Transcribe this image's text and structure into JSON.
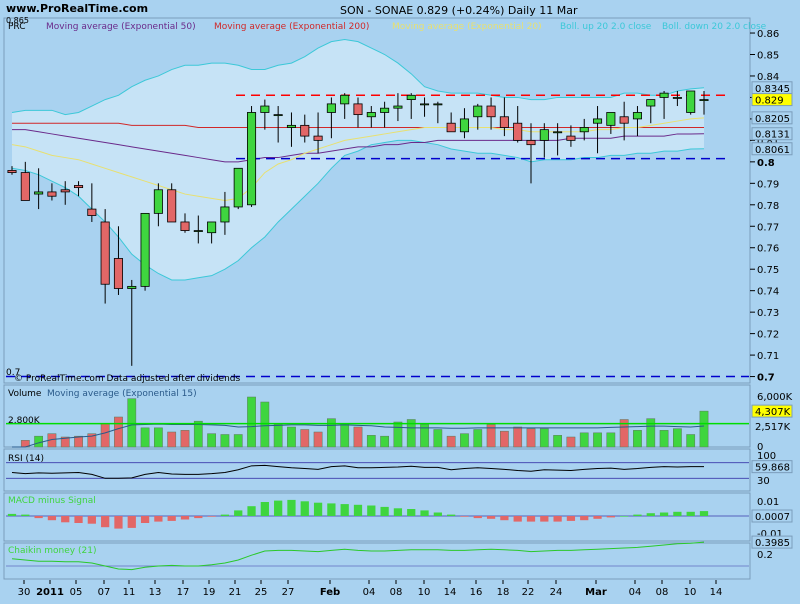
{
  "header": {
    "watermark": "www.ProRealTime.com",
    "title": "SON - SONAE   0.829 (+0.24%)   Daily  11 Mar"
  },
  "price_panel": {
    "legend": [
      "PRC",
      "Moving average (Exponential 50)",
      "Moving average (Exponential 200)",
      "Moving average (Exponential 20)",
      "Boll. up 20 2.0 close",
      "Boll. down 20 2.0 close"
    ],
    "note": "© ProRealTime.com  Data adjusted after dividends",
    "corner_top": "0.865",
    "corner_bottom": "0.7",
    "ticks": [
      "0.86",
      "0.85",
      "0.84",
      "0.83",
      "0.82",
      "0.81",
      "0.8",
      "0.79",
      "0.78",
      "0.77",
      "0.76",
      "0.75",
      "0.74",
      "0.73",
      "0.72",
      "0.71",
      "0.7"
    ],
    "tags": {
      "boll_up": "0.8345",
      "close": "0.829",
      "ema20": "0.8205",
      "ema50": "0.8131",
      "boll_down": "0.8061"
    }
  },
  "volume_panel": {
    "legend": [
      "Volume",
      "Moving average (Exponential 15)"
    ],
    "level_label": "2.800K",
    "ticks": [
      "6,000K",
      "0"
    ],
    "tags": {
      "volume": "4,307K",
      "ma": "2,517K"
    }
  },
  "rsi_panel": {
    "legend": "RSI (14)",
    "ticks": [
      "100",
      "30"
    ],
    "tag": "59.868"
  },
  "macd_panel": {
    "legend": "MACD minus Signal",
    "ticks": [
      "0.01",
      "-0.01"
    ],
    "tag": "0.0007"
  },
  "chaikin_panel": {
    "legend": "Chaikin money (21)",
    "ticks": [
      "0.2"
    ],
    "tag": "0.3985"
  },
  "x_axis": {
    "labels": [
      "30",
      "2011",
      "05",
      "07",
      "11",
      "13",
      "17",
      "19",
      "21",
      "25",
      "27",
      "Feb",
      "04",
      "08",
      "10",
      "14",
      "16",
      "18",
      "22",
      "24",
      "Mar",
      "04",
      "08",
      "10",
      "14"
    ]
  },
  "colors": {
    "up": "#3fd53f",
    "down": "#e26767",
    "bg": "#a9d2f0",
    "boll": "#3cc8d8",
    "ema20": "#e8e070",
    "ema50": "#6a2a8a",
    "ema200": "#d02828",
    "resist": "#ff0000",
    "support": "#0000cc"
  },
  "chart_data": {
    "type": "candlestick",
    "dates": [
      "29 Dec",
      "30 Dec",
      "31 Dec",
      "03 Jan",
      "04 Jan",
      "05 Jan",
      "06 Jan",
      "07 Jan",
      "10 Jan",
      "11 Jan",
      "12 Jan",
      "13 Jan",
      "14 Jan",
      "17 Jan",
      "18 Jan",
      "19 Jan",
      "20 Jan",
      "21 Jan",
      "24 Jan",
      "25 Jan",
      "26 Jan",
      "27 Jan",
      "28 Jan",
      "31 Jan",
      "01 Feb",
      "02 Feb",
      "03 Feb",
      "04 Feb",
      "07 Feb",
      "08 Feb",
      "09 Feb",
      "10 Feb",
      "11 Feb",
      "14 Feb",
      "15 Feb",
      "16 Feb",
      "17 Feb",
      "18 Feb",
      "21 Feb",
      "22 Feb",
      "23 Feb",
      "24 Feb",
      "25 Feb",
      "28 Feb",
      "01 Mar",
      "02 Mar",
      "03 Mar",
      "04 Mar",
      "07 Mar",
      "08 Mar",
      "09 Mar",
      "10 Mar",
      "11 Mar"
    ],
    "open": [
      0.796,
      0.795,
      0.785,
      0.786,
      0.787,
      0.789,
      0.778,
      0.772,
      0.755,
      0.741,
      0.742,
      0.776,
      0.787,
      0.772,
      0.768,
      0.767,
      0.772,
      0.779,
      0.78,
      0.823,
      0.822,
      0.816,
      0.817,
      0.812,
      0.823,
      0.827,
      0.827,
      0.821,
      0.823,
      0.825,
      0.829,
      0.827,
      0.827,
      0.818,
      0.814,
      0.821,
      0.826,
      0.821,
      0.818,
      0.81,
      0.81,
      0.814,
      0.812,
      0.814,
      0.818,
      0.817,
      0.821,
      0.82,
      0.826,
      0.83,
      0.83,
      0.823,
      0.829
    ],
    "high": [
      0.798,
      0.8,
      0.797,
      0.79,
      0.791,
      0.791,
      0.79,
      0.778,
      0.77,
      0.745,
      0.775,
      0.79,
      0.79,
      0.776,
      0.775,
      0.772,
      0.786,
      0.796,
      0.826,
      0.829,
      0.826,
      0.823,
      0.822,
      0.823,
      0.83,
      0.832,
      0.83,
      0.826,
      0.828,
      0.832,
      0.832,
      0.83,
      0.828,
      0.823,
      0.825,
      0.827,
      0.83,
      0.83,
      0.826,
      0.818,
      0.818,
      0.818,
      0.817,
      0.82,
      0.826,
      0.822,
      0.828,
      0.826,
      0.829,
      0.833,
      0.833,
      0.832,
      0.833
    ],
    "low": [
      0.794,
      0.783,
      0.778,
      0.782,
      0.78,
      0.784,
      0.772,
      0.734,
      0.738,
      0.705,
      0.74,
      0.77,
      0.772,
      0.767,
      0.762,
      0.762,
      0.766,
      0.778,
      0.779,
      0.815,
      0.809,
      0.807,
      0.809,
      0.804,
      0.811,
      0.82,
      0.816,
      0.816,
      0.816,
      0.819,
      0.82,
      0.821,
      0.818,
      0.816,
      0.811,
      0.815,
      0.815,
      0.812,
      0.809,
      0.79,
      0.802,
      0.803,
      0.807,
      0.81,
      0.804,
      0.813,
      0.81,
      0.812,
      0.818,
      0.82,
      0.826,
      0.822,
      0.822
    ],
    "close": [
      0.795,
      0.782,
      0.786,
      0.784,
      0.786,
      0.788,
      0.775,
      0.743,
      0.741,
      0.742,
      0.776,
      0.787,
      0.772,
      0.768,
      0.768,
      0.772,
      0.779,
      0.797,
      0.823,
      0.826,
      0.822,
      0.817,
      0.812,
      0.81,
      0.827,
      0.831,
      0.822,
      0.823,
      0.825,
      0.826,
      0.831,
      0.827,
      0.827,
      0.814,
      0.82,
      0.826,
      0.821,
      0.816,
      0.81,
      0.808,
      0.815,
      0.814,
      0.81,
      0.816,
      0.82,
      0.823,
      0.818,
      0.823,
      0.829,
      0.832,
      0.83,
      0.833,
      0.829
    ],
    "volume_K": [
      0,
      800,
      1300,
      1600,
      1200,
      1300,
      1600,
      2800,
      3600,
      5800,
      2300,
      2300,
      1800,
      2000,
      3100,
      1600,
      1500,
      1500,
      6000,
      5400,
      2700,
      2400,
      2100,
      1800,
      3400,
      2800,
      2400,
      1400,
      1300,
      3000,
      3300,
      2700,
      2100,
      1300,
      1600,
      2100,
      2700,
      1900,
      2400,
      2200,
      2200,
      1400,
      1200,
      1700,
      1700,
      1700,
      3300,
      2000,
      3400,
      2000,
      2200,
      1500,
      4307
    ],
    "volume_ema15_K": [
      0,
      0,
      500,
      900,
      1050,
      1200,
      1300,
      1700,
      2200,
      2650,
      2700,
      2750,
      2700,
      2700,
      2700,
      2650,
      2600,
      2400,
      2450,
      2550,
      2600,
      2650,
      2650,
      2600,
      2600,
      2650,
      2600,
      2550,
      2400,
      2350,
      2300,
      2300,
      2300,
      2250,
      2250,
      2300,
      2300,
      2300,
      2300,
      2300,
      2300,
      2300,
      2300,
      2300,
      2300,
      2350,
      2400,
      2450,
      2500,
      2500,
      2450,
      2400,
      2517
    ],
    "ema20": [
      0.808,
      0.807,
      0.805,
      0.803,
      0.802,
      0.801,
      0.799,
      0.797,
      0.795,
      0.793,
      0.791,
      0.789,
      0.787,
      0.785,
      0.784,
      0.783,
      0.782,
      0.783,
      0.788,
      0.795,
      0.799,
      0.801,
      0.804,
      0.806,
      0.808,
      0.81,
      0.811,
      0.812,
      0.813,
      0.814,
      0.815,
      0.816,
      0.816,
      0.816,
      0.816,
      0.816,
      0.816,
      0.815,
      0.815,
      0.814,
      0.814,
      0.814,
      0.814,
      0.814,
      0.815,
      0.815,
      0.816,
      0.816,
      0.817,
      0.818,
      0.819,
      0.82,
      0.8205
    ],
    "ema50": [
      0.815,
      0.815,
      0.814,
      0.813,
      0.812,
      0.811,
      0.81,
      0.809,
      0.808,
      0.807,
      0.806,
      0.805,
      0.804,
      0.803,
      0.802,
      0.801,
      0.8,
      0.8,
      0.801,
      0.802,
      0.802,
      0.803,
      0.804,
      0.804,
      0.805,
      0.806,
      0.807,
      0.807,
      0.808,
      0.808,
      0.809,
      0.809,
      0.81,
      0.81,
      0.81,
      0.81,
      0.81,
      0.81,
      0.81,
      0.81,
      0.81,
      0.81,
      0.811,
      0.811,
      0.811,
      0.811,
      0.812,
      0.812,
      0.812,
      0.812,
      0.813,
      0.813,
      0.8131
    ],
    "ema200": [
      0.818,
      0.818,
      0.818,
      0.818,
      0.818,
      0.818,
      0.818,
      0.818,
      0.818,
      0.817,
      0.817,
      0.817,
      0.817,
      0.817,
      0.816,
      0.816,
      0.816,
      0.816,
      0.816,
      0.816,
      0.816,
      0.816,
      0.816,
      0.816,
      0.816,
      0.816,
      0.816,
      0.816,
      0.816,
      0.816,
      0.816,
      0.816,
      0.816,
      0.816,
      0.816,
      0.816,
      0.816,
      0.816,
      0.816,
      0.816,
      0.816,
      0.816,
      0.816,
      0.816,
      0.816,
      0.816,
      0.816,
      0.816,
      0.816,
      0.816,
      0.816,
      0.816,
      0.816
    ],
    "boll_up": [
      0.823,
      0.824,
      0.824,
      0.824,
      0.822,
      0.823,
      0.826,
      0.829,
      0.831,
      0.835,
      0.838,
      0.84,
      0.843,
      0.845,
      0.845,
      0.846,
      0.846,
      0.845,
      0.843,
      0.843,
      0.845,
      0.846,
      0.849,
      0.853,
      0.856,
      0.857,
      0.856,
      0.853,
      0.85,
      0.846,
      0.841,
      0.835,
      0.833,
      0.832,
      0.832,
      0.832,
      0.831,
      0.83,
      0.83,
      0.829,
      0.829,
      0.83,
      0.83,
      0.83,
      0.83,
      0.83,
      0.832,
      0.832,
      0.831,
      0.831,
      0.833,
      0.834,
      0.8345
    ],
    "boll_down": [
      0.797,
      0.796,
      0.794,
      0.791,
      0.788,
      0.784,
      0.778,
      0.772,
      0.765,
      0.757,
      0.752,
      0.748,
      0.745,
      0.745,
      0.746,
      0.747,
      0.75,
      0.754,
      0.76,
      0.765,
      0.772,
      0.778,
      0.784,
      0.79,
      0.797,
      0.803,
      0.805,
      0.808,
      0.809,
      0.81,
      0.81,
      0.809,
      0.808,
      0.806,
      0.805,
      0.804,
      0.804,
      0.803,
      0.802,
      0.8,
      0.801,
      0.801,
      0.801,
      0.802,
      0.802,
      0.803,
      0.803,
      0.804,
      0.804,
      0.805,
      0.805,
      0.806,
      0.8061
    ],
    "resistance": 0.831,
    "support": 0.8015,
    "support_low": 0.7,
    "rsi": [
      45,
      42,
      44,
      43,
      44,
      45,
      40,
      30,
      30,
      31,
      40,
      45,
      41,
      40,
      40,
      42,
      45,
      52,
      62,
      63,
      60,
      57,
      55,
      53,
      60,
      62,
      57,
      57,
      58,
      59,
      61,
      58,
      58,
      52,
      55,
      57,
      55,
      53,
      50,
      48,
      52,
      51,
      50,
      53,
      55,
      56,
      53,
      55,
      58,
      60,
      59,
      60,
      59.868
    ],
    "macd_hist": [
      0.0003,
      0.0002,
      -0.0003,
      -0.0006,
      -0.0009,
      -0.001,
      -0.0011,
      -0.0016,
      -0.0018,
      -0.0017,
      -0.001,
      -0.0008,
      -0.0007,
      -0.0005,
      -0.0003,
      -0.0001,
      0.0002,
      0.0008,
      0.0014,
      0.002,
      0.0022,
      0.0023,
      0.0021,
      0.0019,
      0.0018,
      0.0017,
      0.0016,
      0.0015,
      0.0013,
      0.0011,
      0.001,
      0.0008,
      0.0005,
      0.0002,
      -0.0001,
      -0.0003,
      -0.0004,
      -0.0006,
      -0.0008,
      -0.0008,
      -0.0008,
      -0.0008,
      -0.0007,
      -0.0006,
      -0.0004,
      -0.0002,
      0.0,
      0.0002,
      0.0004,
      0.0005,
      0.0006,
      0.0006,
      0.0007
    ],
    "chaikin": [
      0.12,
      0.1,
      0.08,
      0.08,
      0.07,
      0.07,
      0.05,
      0.0,
      -0.05,
      -0.06,
      -0.02,
      0.0,
      0.01,
      0.0,
      0.0,
      0.02,
      0.05,
      0.1,
      0.18,
      0.25,
      0.26,
      0.26,
      0.25,
      0.24,
      0.26,
      0.28,
      0.26,
      0.25,
      0.25,
      0.26,
      0.27,
      0.27,
      0.27,
      0.26,
      0.26,
      0.27,
      0.28,
      0.27,
      0.26,
      0.24,
      0.25,
      0.26,
      0.26,
      0.27,
      0.28,
      0.29,
      0.3,
      0.31,
      0.33,
      0.35,
      0.37,
      0.38,
      0.3985
    ],
    "ylim_price": [
      0.697,
      0.867
    ]
  }
}
